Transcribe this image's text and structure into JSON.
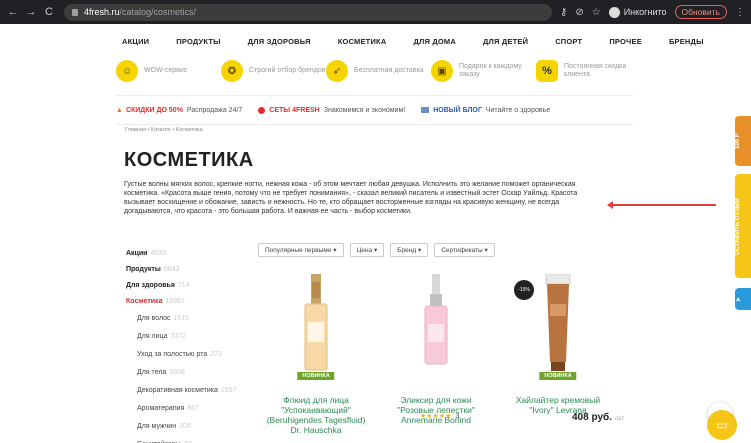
{
  "browser": {
    "url_host": "4fresh.ru",
    "url_path": "/catalog/cosmetics/",
    "incognito_label": "Инкогнито",
    "update_label": "Обновить"
  },
  "topnav": [
    "АКЦИИ",
    "ПРОДУКТЫ",
    "ДЛЯ ЗДОРОВЬЯ",
    "КОСМЕТИКА",
    "ДЛЯ ДОМА",
    "ДЛЯ ДЕТЕЙ",
    "СПОРТ",
    "ПРОЧЕЕ",
    "БРЕНДЫ"
  ],
  "services": [
    {
      "text": "WOW-сервис",
      "icon": "smile-icon"
    },
    {
      "text": "Строгий отбор брендов",
      "icon": "medal-icon"
    },
    {
      "text": "Бесплатная доставка",
      "icon": "rocket-icon"
    },
    {
      "text": "Подарок к каждому заказу",
      "icon": "gift-icon"
    },
    {
      "text": "Постоянная скидка клиента",
      "icon": "percent-icon"
    }
  ],
  "promo": [
    {
      "bold": "СКИДКИ ДО 50%",
      "text": "Распродажа 24/7"
    },
    {
      "bold": "СЕТЫ 4FRESH",
      "text": "Знакомимся и экономим!"
    },
    {
      "bold": "НОВЫЙ БЛОГ",
      "text": "Читайте о здоровье"
    }
  ],
  "breadcrumbs": "Главная • Каталог • Косметика",
  "page_title": "КОСМЕТИКА",
  "description": "Густые волны мягких волос, крепкие ногти, нежная кожа - об этом мечтает любая девушка. Исполнить это желание поможет органическая косметика. «Красота выше гения, потому что не требует понимания», - сказал великий писатель и известный эстет Оскар Уайльд. Красота вызывает восхищение и обожание, зависть и нежность. Но те, кто обращает восторженные взгляды на красивую женщину, не всегда догадываются, что красота - это большая работа. И важная ее часть - выбор косметики.",
  "sidebar": [
    {
      "label": "Акции",
      "count": "4633",
      "type": "main"
    },
    {
      "label": "Продукты",
      "count": "6043",
      "type": "main"
    },
    {
      "label": "Для здоровья",
      "count": "714",
      "type": "main"
    },
    {
      "label": "Косметика",
      "count": "10967",
      "type": "active"
    },
    {
      "label": "Для волос",
      "count": "1615",
      "type": "sub"
    },
    {
      "label": "Для лица",
      "count": "3372",
      "type": "sub"
    },
    {
      "label": "Уход за полостью рта",
      "count": "273",
      "type": "sub"
    },
    {
      "label": "Для тела",
      "count": "3358",
      "type": "sub"
    },
    {
      "label": "Декоративная косметика",
      "count": "1657",
      "type": "sub"
    },
    {
      "label": "Ароматерапия",
      "count": "867",
      "type": "sub"
    },
    {
      "label": "Для мужчин",
      "count": "206",
      "type": "sub"
    },
    {
      "label": "Санитайзеры",
      "count": "32",
      "type": "sub"
    }
  ],
  "filters": [
    "Популярные первыми ▾",
    "Цена ▾",
    "Бренд ▾",
    "Сертификаты ▾"
  ],
  "products": [
    {
      "name": "Флюид для лица \"Успокаивающий\" (Beruhigendes Tagesfluid) Dr. Hauschka",
      "tag": "НОВИНКА"
    },
    {
      "name": "Эликсир для кожи \"Розовые лепестки\" Annemarie Borlind",
      "tag": "",
      "rating_count": "3"
    },
    {
      "name": "Хайлайтер кремовый \"Ivory\" Levrana",
      "tag": "НОВИНКА",
      "discount": "-15%",
      "price": "408 руб.",
      "unit": "/шт"
    }
  ],
  "right_tabs": [
    {
      "label": "100 Р",
      "color": "#e8902a"
    },
    {
      "label": "ОСТАВИТЬ ОТЗЫВ",
      "color": "#f5c518"
    },
    {
      "label": "",
      "color": "#2b9ad9"
    }
  ],
  "colors": {
    "accent": "#e52b2b",
    "product_link": "#2c8a55",
    "new_tag": "#6fa52b",
    "yellow": "#f5d400"
  }
}
